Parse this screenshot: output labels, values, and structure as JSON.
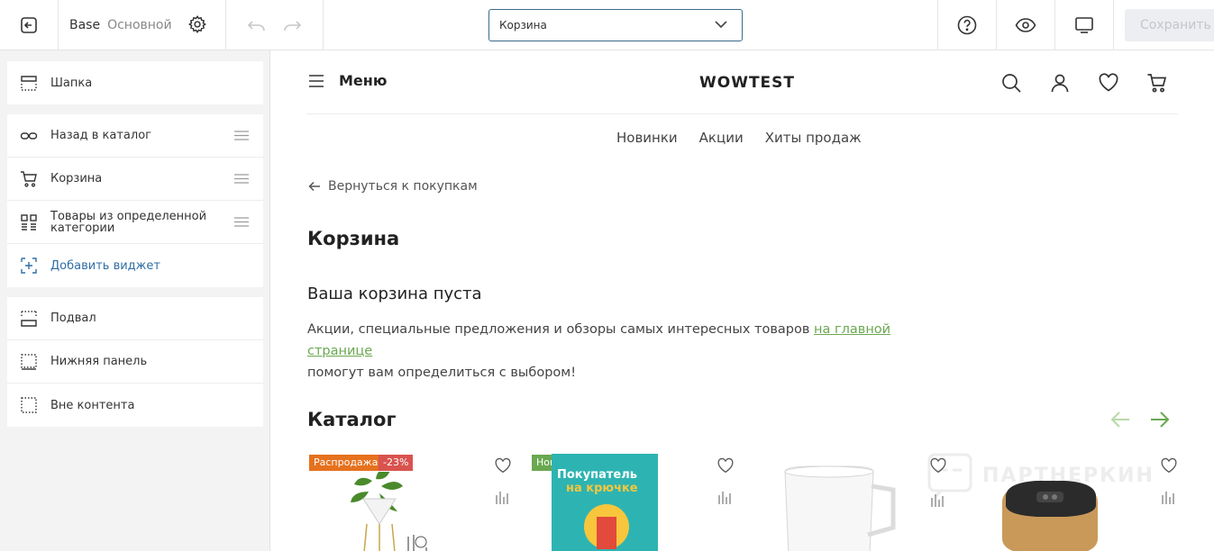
{
  "toolbar": {
    "theme_base": "Base",
    "theme_name": "Основной",
    "page_select": "Корзина",
    "save_label": "Сохранить"
  },
  "sidebar": {
    "header_item": "Шапка",
    "widgets": [
      {
        "label": "Назад в каталог",
        "icon": "back-link-icon"
      },
      {
        "label": "Корзина",
        "icon": "cart-icon"
      },
      {
        "label": "Товары из определенной категории",
        "icon": "grid-icon"
      }
    ],
    "add_widget": "Добавить виджет",
    "bottom_items": [
      {
        "label": "Подвал",
        "icon": "footer-icon"
      },
      {
        "label": "Нижняя панель",
        "icon": "bottom-panel-icon"
      },
      {
        "label": "Вне контента",
        "icon": "outside-content-icon"
      }
    ]
  },
  "preview": {
    "menu_label": "Меню",
    "brand": "WOWTEST",
    "nav": [
      "Новинки",
      "Акции",
      "Хиты продаж"
    ],
    "back_link": "Вернуться к покупкам",
    "page_title": "Корзина",
    "empty_title": "Ваша корзина пуста",
    "desc_before": "Акции, специальные предложения и обзоры самых интересных товаров ",
    "desc_link": "на главной странице",
    "desc_after": "помогут вам определиться с выбором!",
    "catalog_title": "Каталог",
    "badges": {
      "sale": "Распродажа",
      "discount": "-23%",
      "new": "Новинка"
    },
    "book_title_1": "Покупатель",
    "book_title_2": "на крючке",
    "watermark": "ПАРТНЕРКИН"
  },
  "colors": {
    "accent_green": "#6aa84f",
    "sale_badge": "#e6711e",
    "discount_badge": "#d9534f",
    "new_badge": "#6aa84f",
    "select_border": "#3c6b8a"
  }
}
